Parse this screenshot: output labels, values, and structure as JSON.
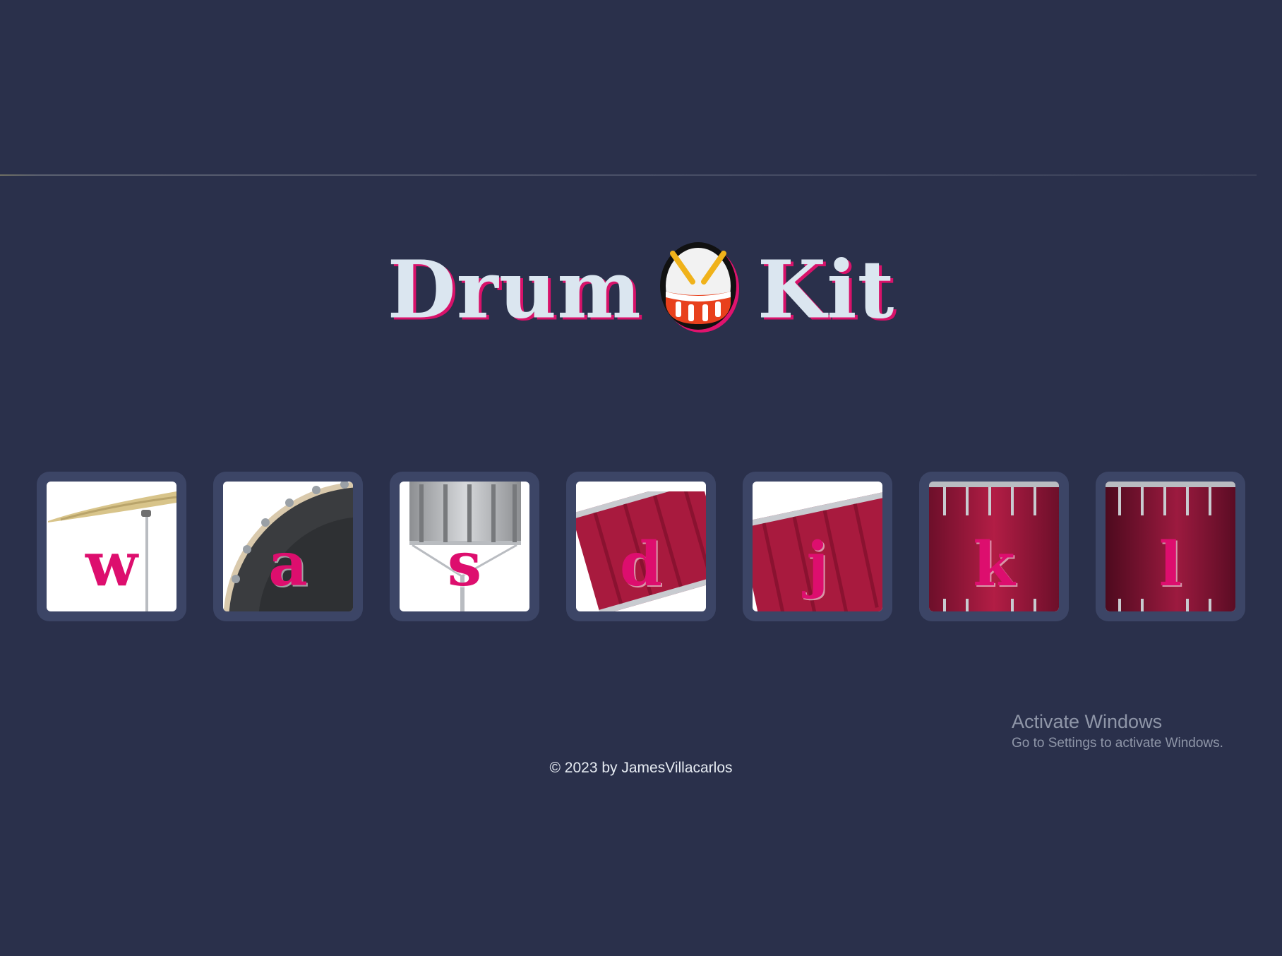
{
  "header": {
    "title_left": "Drum",
    "title_right": "Kit",
    "title_icon": "drum-emoji-icon",
    "accent_color": "#dd0e6e",
    "title_color": "#dbe6f0"
  },
  "pads": [
    {
      "key": "w",
      "instrument": "crash-cymbal-icon"
    },
    {
      "key": "a",
      "instrument": "kick-drum-icon"
    },
    {
      "key": "s",
      "instrument": "snare-drum-icon"
    },
    {
      "key": "d",
      "instrument": "tom-1-icon"
    },
    {
      "key": "j",
      "instrument": "tom-2-icon"
    },
    {
      "key": "k",
      "instrument": "tom-3-icon"
    },
    {
      "key": "l",
      "instrument": "tom-4-icon"
    }
  ],
  "footer": {
    "copyright": "© 2023 by JamesVillacarlos"
  },
  "watermark": {
    "title": "Activate Windows",
    "subtitle": "Go to Settings to activate Windows."
  },
  "colors": {
    "background": "#2a304b",
    "pad_frame": "#3c4566",
    "drum_red": "#a5173d"
  }
}
